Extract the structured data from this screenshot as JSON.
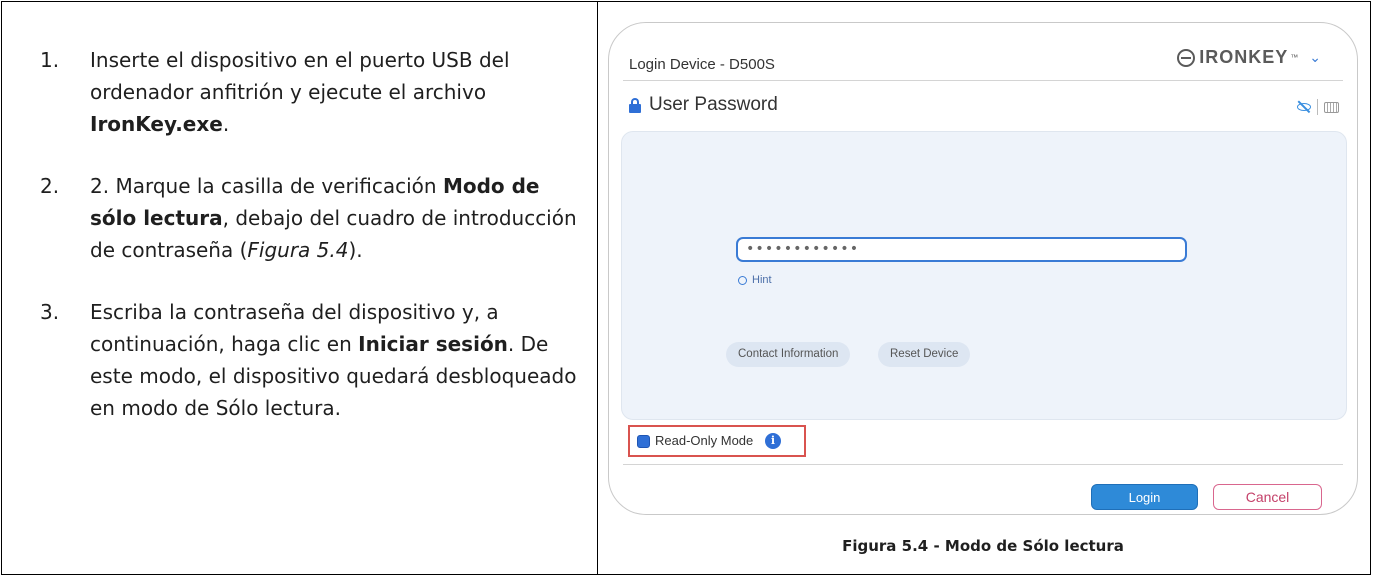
{
  "instructions": [
    {
      "number": "1.",
      "pre": "Inserte el dispositivo en el puerto USB del ordenador anfitrión y ejecute el archivo ",
      "bold": "IronKey.exe",
      "post": "."
    },
    {
      "number": "2.",
      "pre": "2. Marque la casilla de verificación ",
      "bold": "Modo de sólo lectura",
      "mid": ", debajo del cuadro de introducción de contraseña (",
      "italic": "Figura 5.4",
      "post": ")."
    },
    {
      "number": "3.",
      "pre": "Escriba la contraseña del dispositivo y, a continuación, haga clic en ",
      "bold": "Iniciar sesión",
      "post": ". De este modo, el dispositivo quedará desbloqueado en modo de Sólo lectura."
    }
  ],
  "app": {
    "window_title": "Login Device - D500S",
    "brand": "IRONKEY",
    "brand_tm": "™",
    "heading": "User Password",
    "password_mask": "••••••••••••",
    "hint_label": "Hint",
    "contact_button": "Contact Information",
    "reset_button": "Reset Device",
    "readonly_label": "Read-Only Mode",
    "readonly_checked": true,
    "info_glyph": "i",
    "login_button": "Login",
    "cancel_button": "Cancel",
    "accent_color": "#2e8ad8",
    "cancel_color": "#c4416a",
    "highlight_color": "#d9534f"
  },
  "caption": "Figura 5.4 - Modo de Sólo lectura"
}
